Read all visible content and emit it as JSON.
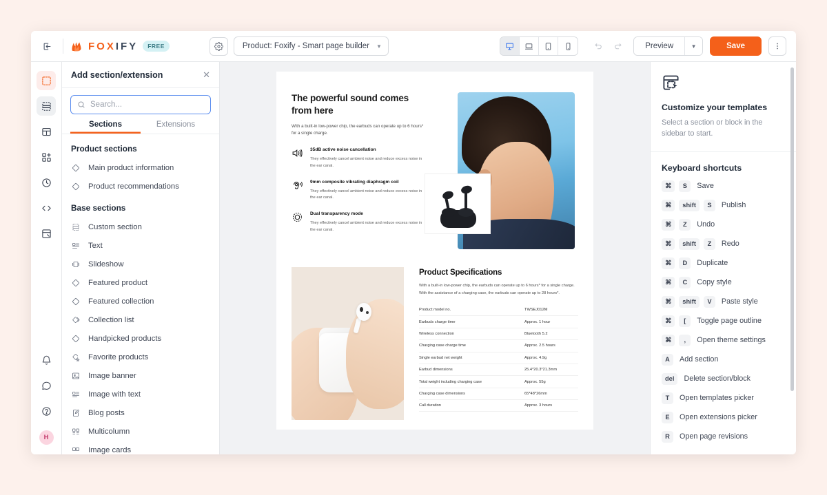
{
  "topbar": {
    "collapse_icon": "collapse-sidebar-icon",
    "logo_fox": "FOX",
    "logo_ify": "IFY",
    "plan_badge": "FREE",
    "settings_icon": "gear-icon",
    "page_selector": "Product: Foxify - Smart page builder",
    "devices": [
      {
        "name": "desktop",
        "active": true
      },
      {
        "name": "laptop",
        "active": false
      },
      {
        "name": "tablet",
        "active": false
      },
      {
        "name": "mobile",
        "active": false
      }
    ],
    "undo_icon": "undo-icon",
    "redo_icon": "redo-icon",
    "preview_label": "Preview",
    "save_label": "Save",
    "kebab_icon": "more-vertical-icon"
  },
  "rail": {
    "items": [
      {
        "name": "add-section",
        "icon": "add-section-icon",
        "state": "selected-orange"
      },
      {
        "name": "page-outline",
        "icon": "page-outline-icon",
        "state": "selected-gray"
      },
      {
        "name": "templates",
        "icon": "templates-icon",
        "state": ""
      },
      {
        "name": "extensions",
        "icon": "extensions-icon",
        "state": ""
      },
      {
        "name": "revisions",
        "icon": "clock-icon",
        "state": ""
      },
      {
        "name": "custom-code",
        "icon": "code-icon",
        "state": ""
      },
      {
        "name": "theme-settings",
        "icon": "theme-settings-icon",
        "state": ""
      }
    ],
    "bottom": [
      {
        "name": "notifications",
        "icon": "bell-icon"
      },
      {
        "name": "feedback",
        "icon": "chat-icon"
      },
      {
        "name": "help",
        "icon": "question-circle-icon"
      }
    ],
    "avatar_initial": "H"
  },
  "panel": {
    "title": "Add section/extension",
    "close_icon": "close-icon",
    "search_placeholder": "Search...",
    "search_value": "",
    "tabs": [
      {
        "label": "Sections",
        "active": true
      },
      {
        "label": "Extensions",
        "active": false
      }
    ],
    "groups": [
      {
        "title": "Product sections",
        "items": [
          {
            "label": "Main product information",
            "icon": "tag-icon"
          },
          {
            "label": "Product recommendations",
            "icon": "tag-icon"
          }
        ]
      },
      {
        "title": "Base sections",
        "items": [
          {
            "label": "Custom section",
            "icon": "custom-section-icon"
          },
          {
            "label": "Text",
            "icon": "text-icon"
          },
          {
            "label": "Slideshow",
            "icon": "slideshow-icon"
          },
          {
            "label": "Featured product",
            "icon": "tag-icon"
          },
          {
            "label": "Featured collection",
            "icon": "tag-icon"
          },
          {
            "label": "Collection list",
            "icon": "tags-icon"
          },
          {
            "label": "Handpicked products",
            "icon": "tag-icon"
          },
          {
            "label": "Favorite products",
            "icon": "favorite-tag-icon"
          },
          {
            "label": "Image banner",
            "icon": "image-banner-icon"
          },
          {
            "label": "Image with text",
            "icon": "image-with-text-icon"
          },
          {
            "label": "Blog posts",
            "icon": "blog-icon"
          },
          {
            "label": "Multicolumn",
            "icon": "multicolumn-icon"
          },
          {
            "label": "Image cards",
            "icon": "image-cards-icon"
          }
        ]
      }
    ]
  },
  "canvas": {
    "hero": {
      "heading": "The powerful sound comes from here",
      "subtext": "With a built-in low-power chip, the earbuds can operate up to 6 hours* for a single charge.",
      "features": [
        {
          "icon": "speaker-noise-icon",
          "title": "35dB active noise cancellation",
          "desc": "They effectively cancel ambient noise and reduce excess noise in the ear canal."
        },
        {
          "icon": "ear-diaphragm-icon",
          "title": "9mm composite vibrating diaphragm coil",
          "desc": "They effectively cancel ambient noise and reduce excess noise in the ear canal."
        },
        {
          "icon": "transparency-mode-icon",
          "title": "Dual transparency mode",
          "desc": "They effectively cancel ambient noise and reduce excess noise in the ear canal."
        }
      ],
      "photo_person_alt": "person-wearing-earbud-photo",
      "photo_buds_alt": "black-earbuds-product-photo"
    },
    "specs": {
      "photo_hands_alt": "hands-holding-earbuds-case-photo",
      "heading": "Product Specifications",
      "intro": "With a built-in low-power chip, the earbuds can operate up to 6 hours* for a single charge. With the assistance of a charging case, the earbuds can operate up to 28 hours*.",
      "rows": [
        {
          "key": "Product model no.",
          "value": "TWSEJ012M"
        },
        {
          "key": "Earbuds charge time",
          "value": "Approx. 1 hour"
        },
        {
          "key": "Wireless connection",
          "value": "Bluetooth 5.2"
        },
        {
          "key": "Charging case charge time",
          "value": "Approx. 2.5 hours"
        },
        {
          "key": "Single earbud net weight",
          "value": "Approx. 4.9g"
        },
        {
          "key": "Earbud dimensions",
          "value": "25.4*20.3*21.3mm"
        },
        {
          "key": "Total weight including charging case",
          "value": "Approx. 55g"
        },
        {
          "key": "Charging case dimensions",
          "value": "65*48*26mm"
        },
        {
          "key": "Call duration",
          "value": "Approx. 3 hours"
        }
      ]
    }
  },
  "inspector": {
    "icon": "customize-template-icon",
    "title": "Customize your templates",
    "subtitle": "Select a section or block in the sidebar to start.",
    "shortcuts_title": "Keyboard shortcuts",
    "shortcuts": [
      {
        "keys": [
          "⌘",
          "S"
        ],
        "label": "Save"
      },
      {
        "keys": [
          "⌘",
          "shift",
          "S"
        ],
        "label": "Publish"
      },
      {
        "keys": [
          "⌘",
          "Z"
        ],
        "label": "Undo"
      },
      {
        "keys": [
          "⌘",
          "shift",
          "Z"
        ],
        "label": "Redo"
      },
      {
        "keys": [
          "⌘",
          "D"
        ],
        "label": "Duplicate"
      },
      {
        "keys": [
          "⌘",
          "C"
        ],
        "label": "Copy style"
      },
      {
        "keys": [
          "⌘",
          "shift",
          "V"
        ],
        "label": "Paste style"
      },
      {
        "keys": [
          "⌘",
          "["
        ],
        "label": "Toggle page outline"
      },
      {
        "keys": [
          "⌘",
          ","
        ],
        "label": "Open theme settings"
      },
      {
        "keys": [
          "A"
        ],
        "label": "Add section"
      },
      {
        "keys": [
          "del"
        ],
        "label": "Delete section/block"
      },
      {
        "keys": [
          "T"
        ],
        "label": "Open templates picker"
      },
      {
        "keys": [
          "E"
        ],
        "label": "Open extensions picker"
      },
      {
        "keys": [
          "R"
        ],
        "label": "Open page revisions"
      }
    ]
  },
  "colors": {
    "brand_orange": "#f4601a",
    "badge_cyan": "#d4f1f4",
    "canvas_bg": "#f1f2f4",
    "page_bg": "#fdf1ec",
    "focus_blue": "#5b8def",
    "avatar_pink": "#fbd5e0"
  }
}
